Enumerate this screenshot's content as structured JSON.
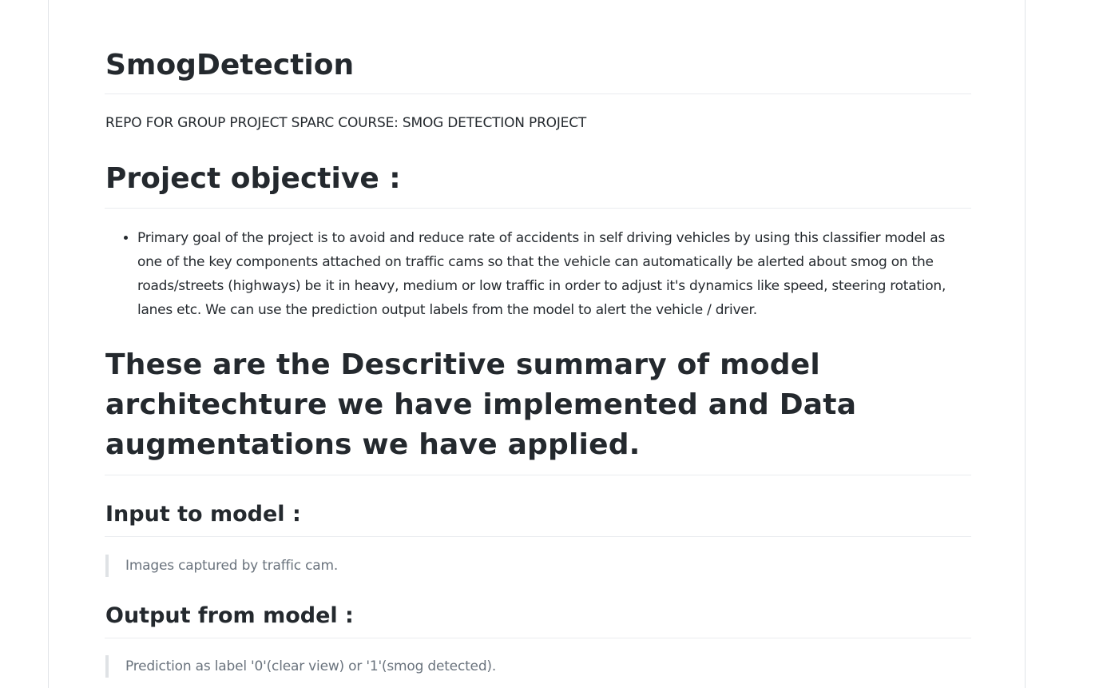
{
  "readme": {
    "title": "SmogDetection",
    "tagline": "REPO FOR GROUP PROJECT SPARC COURSE: SMOG DETECTION PROJECT",
    "objective_heading": "Project objective :",
    "objective_items": [
      "Primary goal of the project is to avoid and reduce rate of accidents in self driving vehicles by using this classifier model as one of the key components attached on traffic cams so that the vehicle can automatically be alerted about smog on the roads/streets (highways) be it in heavy, medium or low traffic in order to adjust it's dynamics like speed, steering rotation, lanes etc. We can use the prediction output labels from the model to alert the vehicle / driver."
    ],
    "summary_heading": "These are the Descritive summary of model architechture we have implemented and Data augmentations we have applied.",
    "input_heading": "Input to model :",
    "input_quote": "Images captured by traffic cam.",
    "output_heading": "Output from model :",
    "output_quote": "Prediction as label '0'(clear view) or '1'(smog detected)."
  }
}
